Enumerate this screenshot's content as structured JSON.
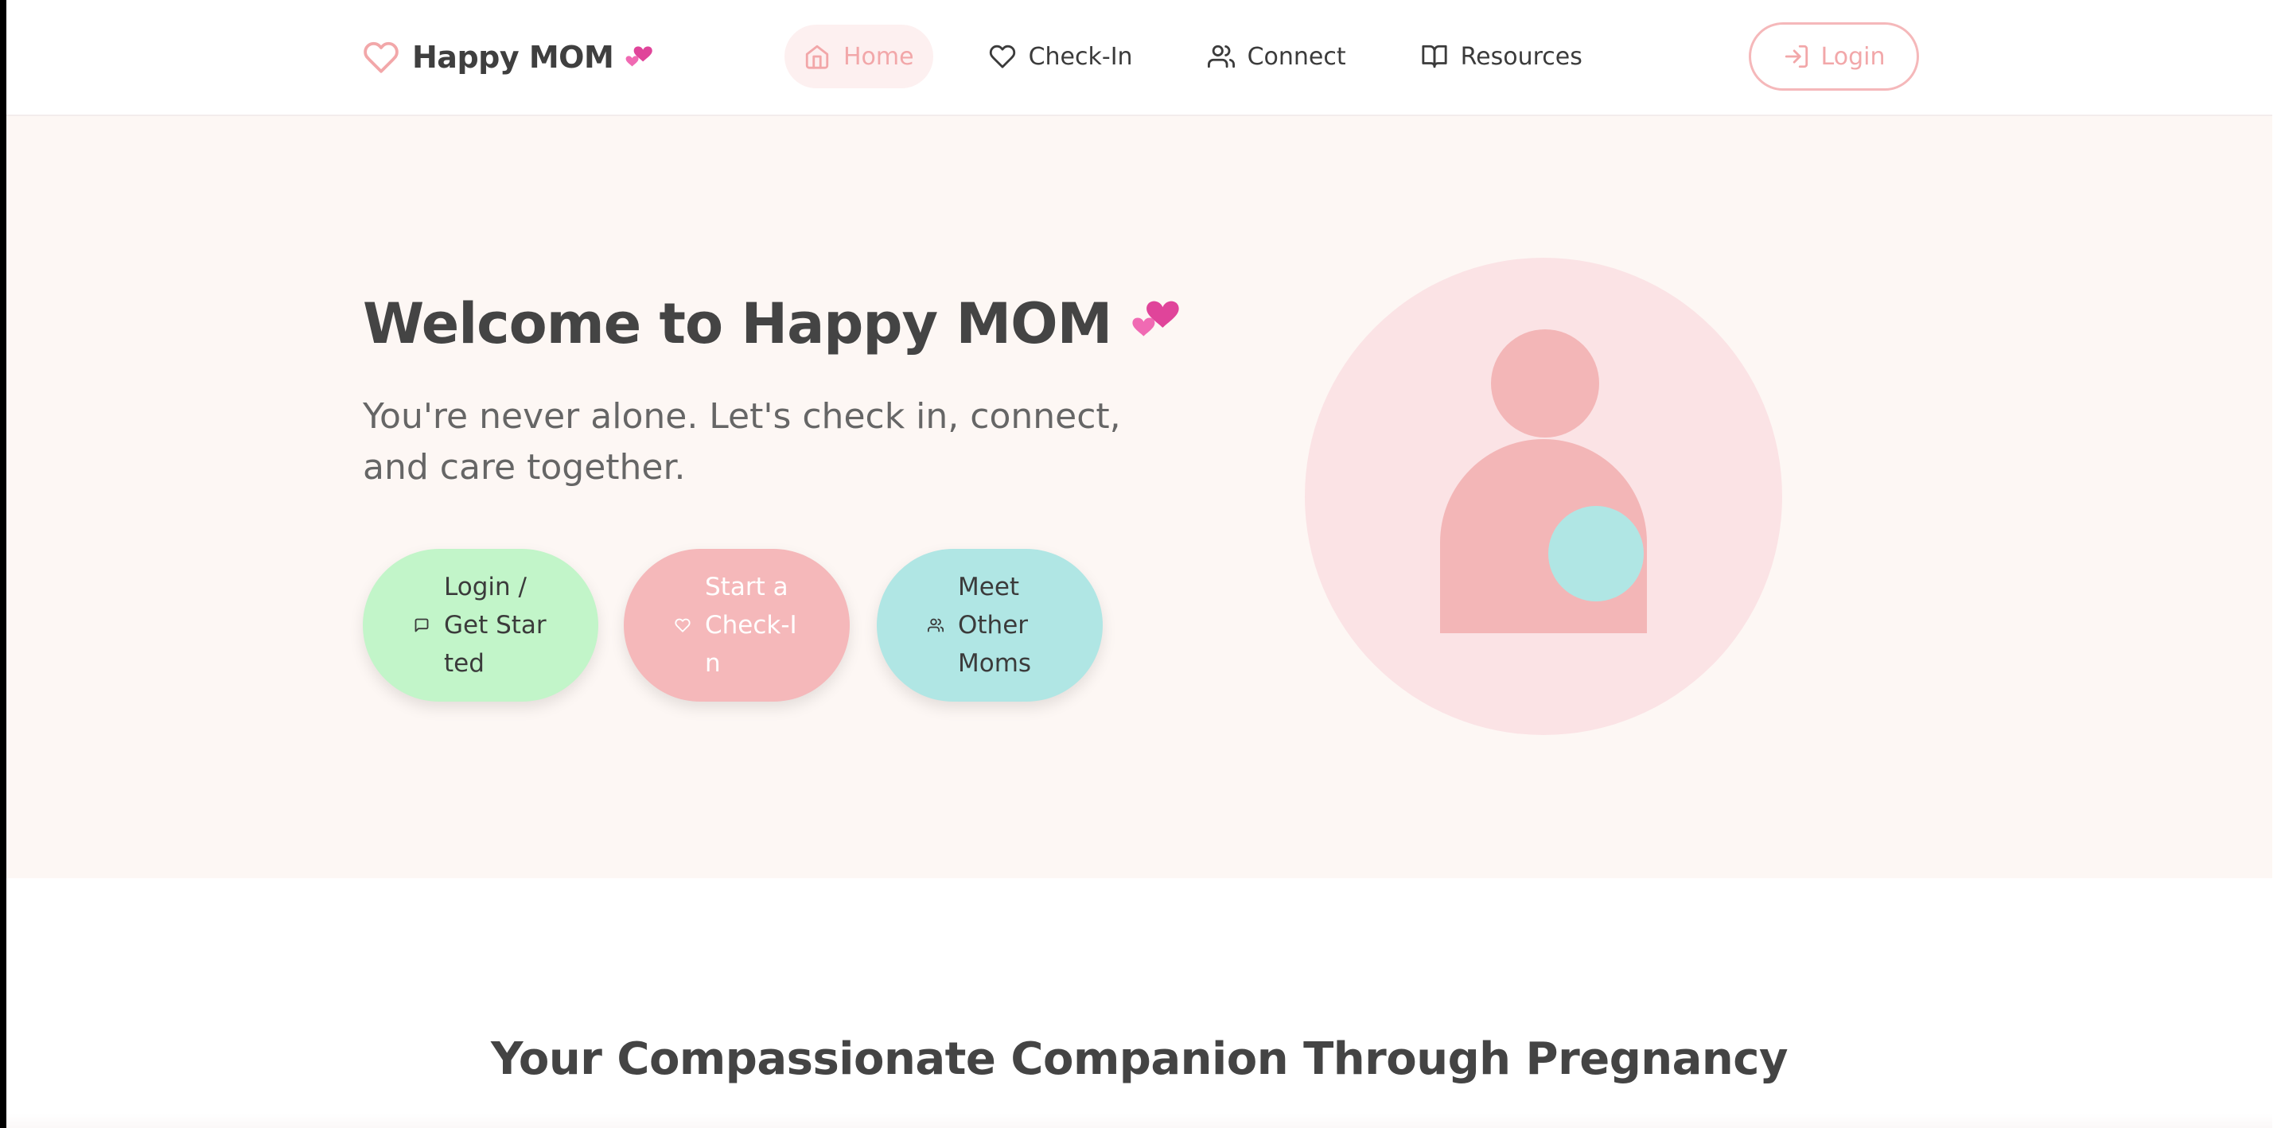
{
  "brand": {
    "name": "Happy MOM",
    "emoji": "💕",
    "icon": "heart-outline-icon"
  },
  "nav": {
    "items": [
      {
        "label": "Home",
        "icon": "home-icon",
        "active": true
      },
      {
        "label": "Check-In",
        "icon": "heart-icon",
        "active": false
      },
      {
        "label": "Connect",
        "icon": "users-icon",
        "active": false
      },
      {
        "label": "Resources",
        "icon": "book-open-icon",
        "active": false
      }
    ],
    "login_label": "Login",
    "login_icon": "log-in-icon"
  },
  "hero": {
    "title": "Welcome to Happy MOM",
    "title_emoji": "💕",
    "subtitle": "You're never alone. Let's check in, connect, and care together.",
    "buttons": [
      {
        "label": "Login / Get Started",
        "icon": "message-square-icon"
      },
      {
        "label": "Start a Check-In",
        "icon": "heart-icon"
      },
      {
        "label": "Meet Other Moms",
        "icon": "users-icon"
      }
    ],
    "illustration": "pregnant-mom-illustration"
  },
  "section": {
    "title": "Your Compassionate Companion Through Pregnancy"
  },
  "colors": {
    "accent_pink": "#f2a7a9",
    "pink_soft": "#f5b8ba",
    "mint": "#c2f5c9",
    "teal": "#b0e6e4",
    "hero_bg": "#fdf7f4",
    "text_dark": "#444444"
  }
}
